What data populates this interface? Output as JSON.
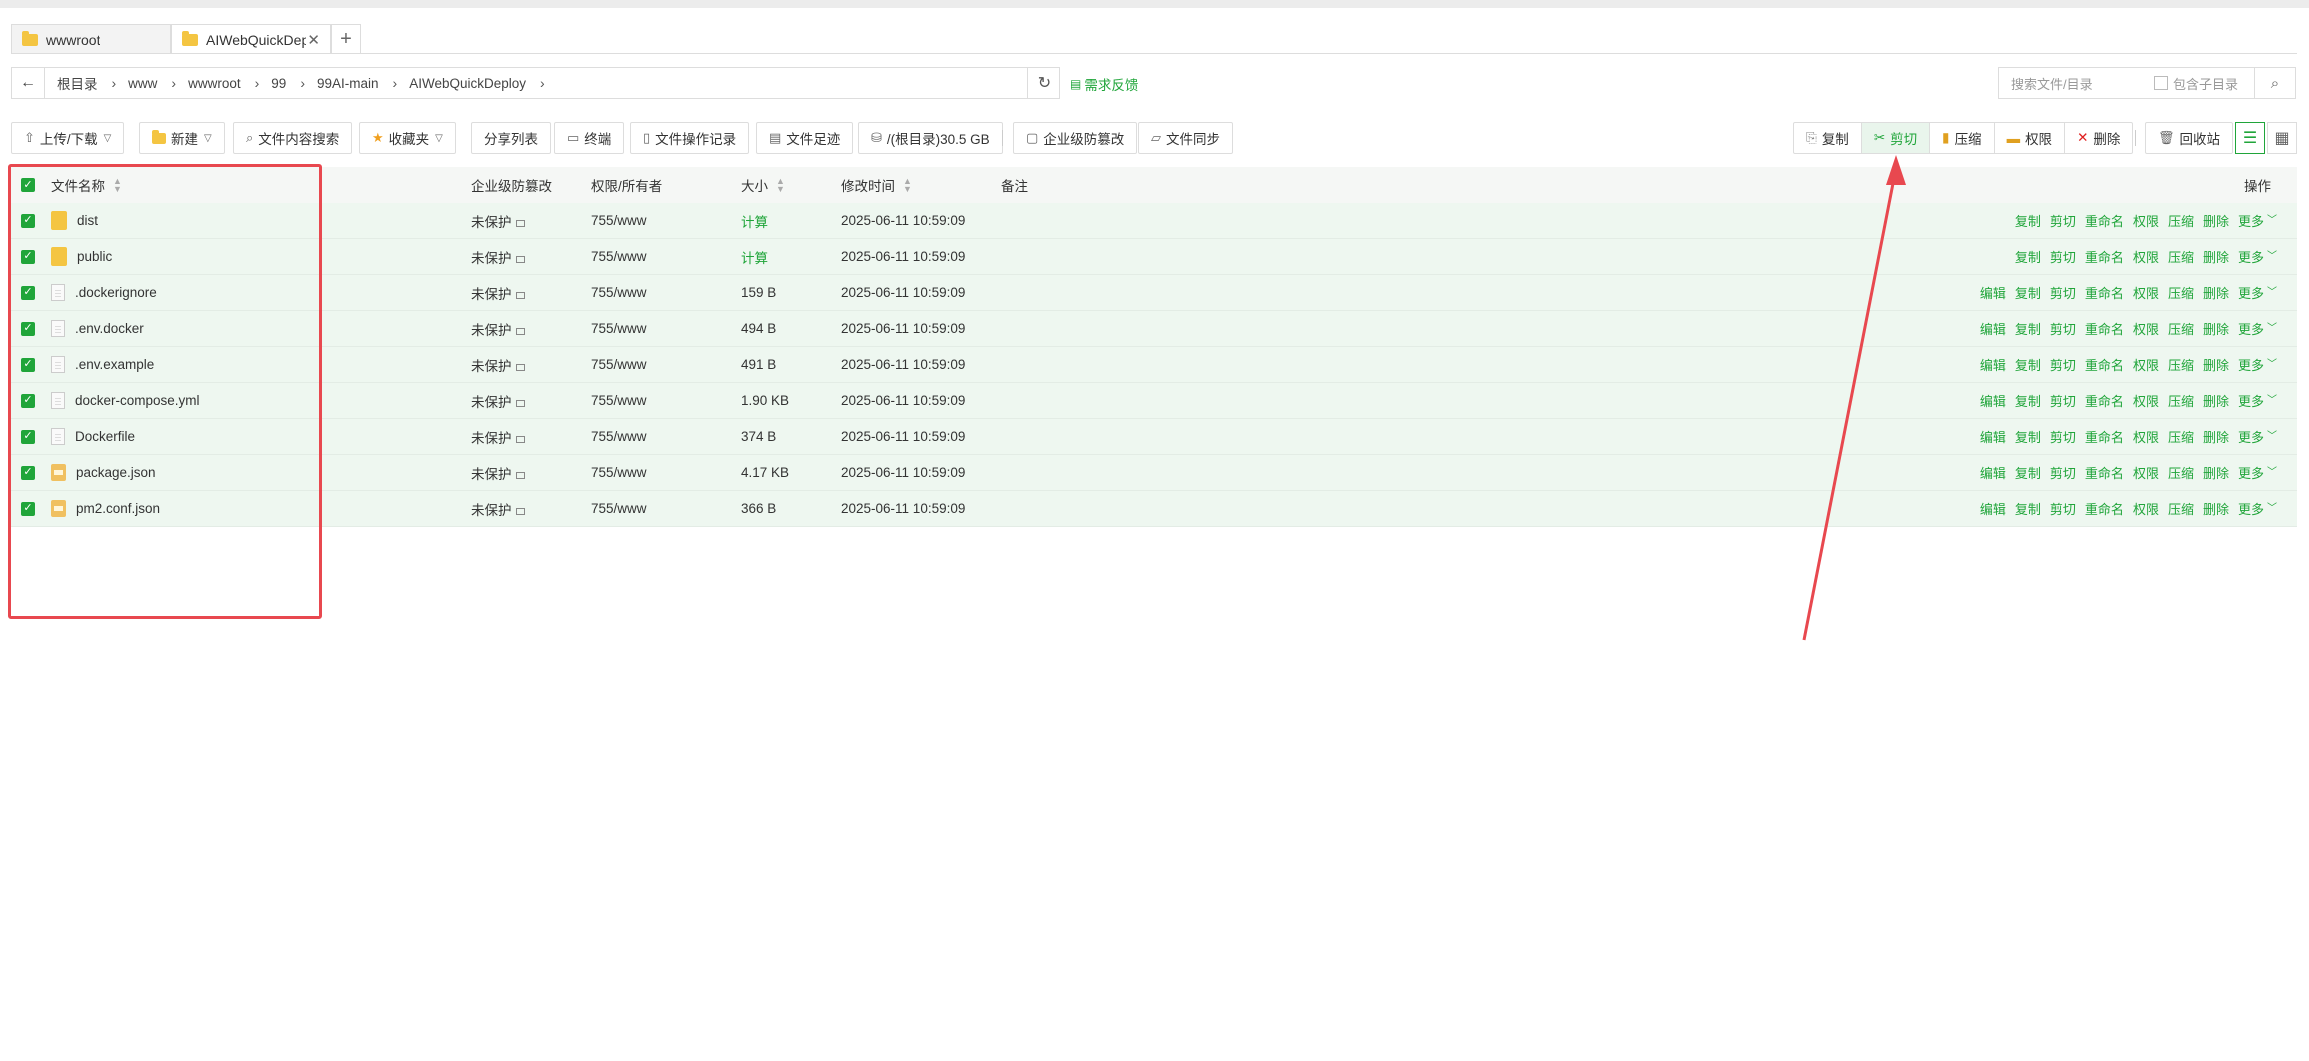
{
  "tabs": [
    {
      "label": "wwwroot",
      "active": false
    },
    {
      "label": "AIWebQuickDeplo",
      "active": true
    }
  ],
  "new_tab_symbol": "+",
  "breadcrumb": [
    "根目录",
    "www",
    "wwwroot",
    "99",
    "99AI-main",
    "AIWebQuickDeploy"
  ],
  "feedback_label": "需求反馈",
  "search": {
    "placeholder": "搜索文件/目录",
    "include_sub_label": "包含子目录"
  },
  "toolbar": {
    "upload": "上传/下载",
    "new": "新建",
    "content_search": "文件内容搜索",
    "favorites": "收藏夹",
    "share_list": "分享列表",
    "terminal": "终端",
    "op_log": "文件操作记录",
    "footprint": "文件足迹",
    "disk": "/(根目录)30.5 GB",
    "tamper": "企业级防篡改",
    "sync": "文件同步"
  },
  "batch_actions": {
    "copy": "复制",
    "cut": "剪切",
    "compress": "压缩",
    "perm": "权限",
    "delete": "删除"
  },
  "recycle": "回收站",
  "columns": {
    "name": "文件名称",
    "tamper": "企业级防篡改",
    "perm": "权限/所有者",
    "size": "大小",
    "mtime": "修改时间",
    "note": "备注",
    "ops": "操作"
  },
  "files": [
    {
      "name": "dist",
      "kind": "dir",
      "tamper": "未保护",
      "perm": "755/www",
      "size": "计算",
      "mtime": "2025-06-11 10:59:09"
    },
    {
      "name": "public",
      "kind": "dir",
      "tamper": "未保护",
      "perm": "755/www",
      "size": "计算",
      "mtime": "2025-06-11 10:59:09"
    },
    {
      "name": ".dockerignore",
      "kind": "file",
      "tamper": "未保护",
      "perm": "755/www",
      "size": "159 B",
      "mtime": "2025-06-11 10:59:09"
    },
    {
      "name": ".env.docker",
      "kind": "file",
      "tamper": "未保护",
      "perm": "755/www",
      "size": "494 B",
      "mtime": "2025-06-11 10:59:09"
    },
    {
      "name": ".env.example",
      "kind": "file",
      "tamper": "未保护",
      "perm": "755/www",
      "size": "491 B",
      "mtime": "2025-06-11 10:59:09"
    },
    {
      "name": "docker-compose.yml",
      "kind": "file",
      "tamper": "未保护",
      "perm": "755/www",
      "size": "1.90 KB",
      "mtime": "2025-06-11 10:59:09"
    },
    {
      "name": "Dockerfile",
      "kind": "file",
      "tamper": "未保护",
      "perm": "755/www",
      "size": "374 B",
      "mtime": "2025-06-11 10:59:09"
    },
    {
      "name": "package.json",
      "kind": "json",
      "tamper": "未保护",
      "perm": "755/www",
      "size": "4.17 KB",
      "mtime": "2025-06-11 10:59:09"
    },
    {
      "name": "pm2.conf.json",
      "kind": "json",
      "tamper": "未保护",
      "perm": "755/www",
      "size": "366 B",
      "mtime": "2025-06-11 10:59:09"
    }
  ],
  "row_ops_dir": [
    "复制",
    "剪切",
    "重命名",
    "权限",
    "压缩",
    "删除",
    "更多"
  ],
  "row_ops_file": [
    "编辑",
    "复制",
    "剪切",
    "重命名",
    "权限",
    "压缩",
    "删除",
    "更多"
  ],
  "colors": {
    "accent": "#20a53a",
    "annotation": "#e8484f"
  }
}
